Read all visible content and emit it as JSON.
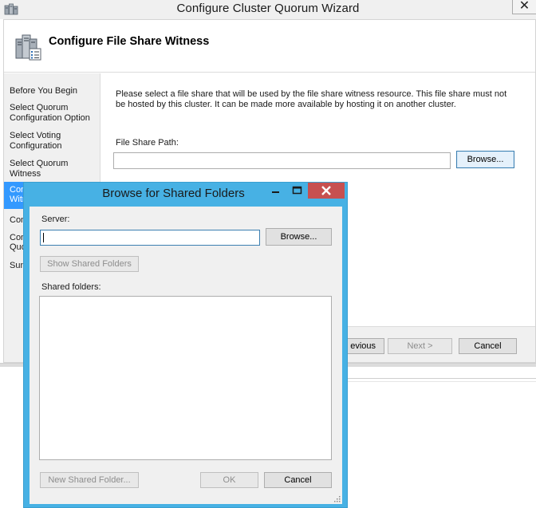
{
  "wizard": {
    "window_title": "Configure Cluster Quorum Wizard",
    "close_glyph": "✕",
    "header_title": "Configure File Share Witness",
    "nav": [
      {
        "label": "Before You Begin"
      },
      {
        "label": "Select Quorum Configuration Option"
      },
      {
        "label": "Select Voting Configuration"
      },
      {
        "label": "Select Quorum Witness"
      },
      {
        "label": "Configure File Share Witness",
        "visible_text": "Conf Witn",
        "active": true
      },
      {
        "label": "Confirmation",
        "visible_text": "Con"
      },
      {
        "label": "Configure Cluster Quorum Settings",
        "visible_text": "Con Quo"
      },
      {
        "label": "Summary",
        "visible_text": "Sun"
      }
    ],
    "description": "Please select a file share that will be used by the file share witness resource.  This file share must not be hosted by this cluster.  It can be made more available by hosting it on another cluster.",
    "file_share_path_label": "File Share Path:",
    "file_share_path_value": "",
    "browse_label": "Browse...",
    "previous_visible": "evious",
    "next_label": "Next >",
    "cancel_label": "Cancel"
  },
  "browse_dialog": {
    "title": "Browse for Shared Folders",
    "server_label": "Server:",
    "server_value": "",
    "browse_label": "Browse...",
    "show_shared_label": "Show Shared Folders",
    "shared_folders_label": "Shared folders:",
    "shared_folders": [],
    "new_folder_label": "New Shared Folder...",
    "ok_label": "OK",
    "cancel_label": "Cancel"
  },
  "colors": {
    "dialog_frame": "#47b1e4",
    "close_button": "#c75050",
    "selection": "#3399ff"
  }
}
